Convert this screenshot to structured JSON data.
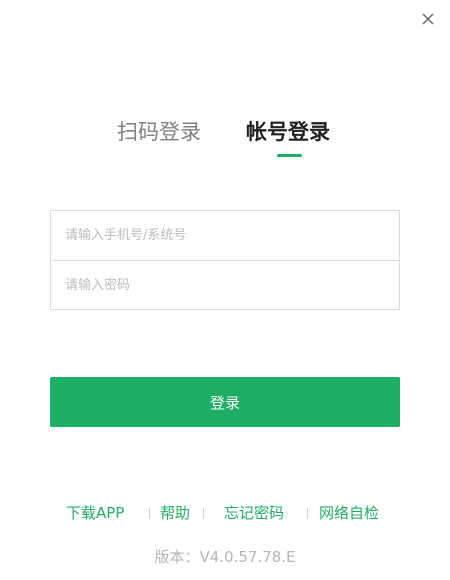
{
  "window": {
    "close_icon": "close-icon"
  },
  "tabs": {
    "qr_label": "扫码登录",
    "account_label": "帐号登录",
    "active": "account"
  },
  "form": {
    "account_placeholder": "请输入手机号/系统号",
    "account_value": "",
    "password_placeholder": "请输入密码",
    "password_value": ""
  },
  "login_button": {
    "label": "登录"
  },
  "links": {
    "download": "下载APP",
    "help": "帮助",
    "forgot": "忘记密码",
    "network_check": "网络自检"
  },
  "version": {
    "label": "版本：V4.0.57.78.E"
  },
  "colors": {
    "accent": "#1fae65",
    "tab_inactive": "#808080",
    "tab_active": "#222222",
    "border": "#dcdcdc",
    "placeholder": "#bdbdbd",
    "version_text": "#b5b5b5"
  }
}
